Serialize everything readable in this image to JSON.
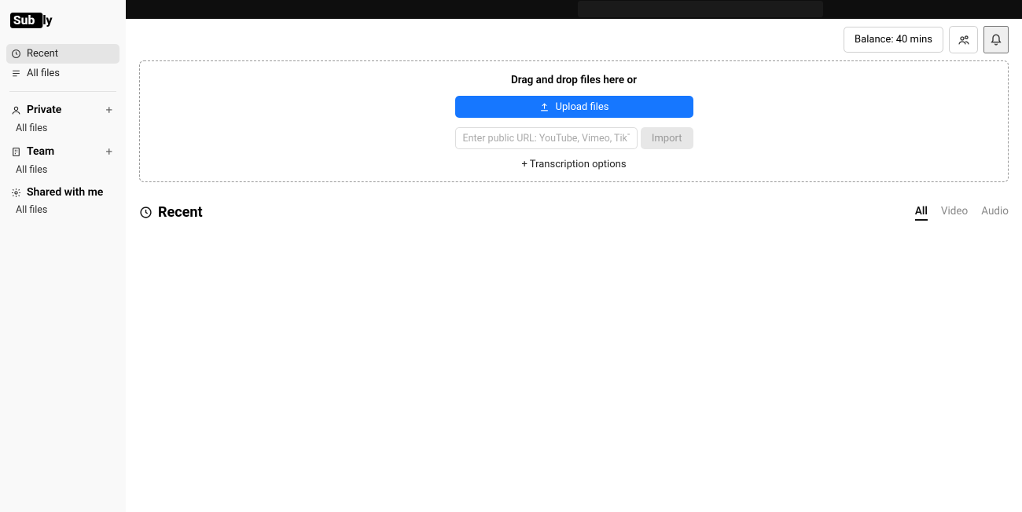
{
  "logo_text": "Subly",
  "sidebar": {
    "recent_label": "Recent",
    "all_files_label": "All files",
    "private_label": "Private",
    "private_all_files": "All files",
    "team_label": "Team",
    "team_all_files": "All files",
    "shared_label": "Shared with me",
    "shared_all_files": "All files"
  },
  "header": {
    "balance_label": "Balance: 40 mins"
  },
  "dropzone": {
    "drag_text": "Drag and drop files here or",
    "upload_label": "Upload files",
    "url_placeholder": "Enter public URL: YouTube, Vimeo, TikTok...",
    "import_label": "Import",
    "options_label": "+ Transcription options"
  },
  "recent_section": {
    "title": "Recent",
    "filters": {
      "all": "All",
      "video": "Video",
      "audio": "Audio"
    }
  },
  "colors": {
    "primary": "#1677ff",
    "sidebar_bg": "#f9f9f9",
    "topbar_bg": "#0e0e0e"
  }
}
